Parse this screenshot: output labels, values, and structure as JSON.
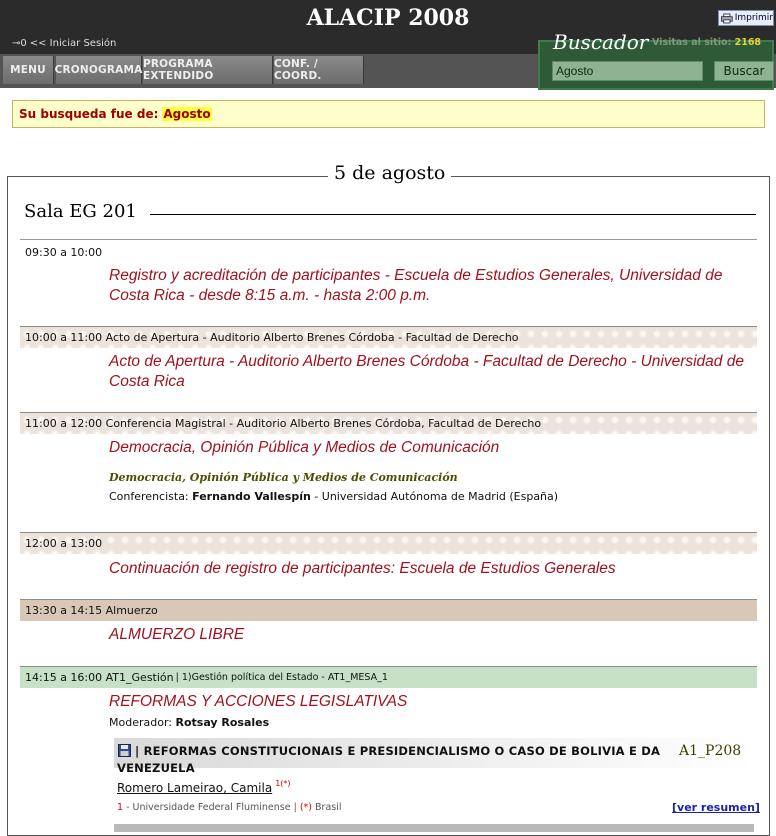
{
  "header": {
    "site_title": "ALACIP 2008",
    "print_label": "Imprimir",
    "login_label": "<< Iniciar Sesión",
    "tabs": [
      "MENU",
      "CRONOGRAMA",
      "PROGRAMA EXTENDIDO",
      "CONF. / COORD."
    ],
    "search": {
      "title": "Buscador",
      "visits_label": "Visitas al sitio:",
      "visits_count": "2168",
      "query": "Agosto",
      "button_label": "Buscar"
    }
  },
  "result_note": {
    "label": "Su busqueda fue de:",
    "term": "Agosto"
  },
  "day_title": "5 de agosto",
  "room_title": "Sala EG 201",
  "slots": [
    {
      "time": "09:30 a 10:00",
      "header_rest": "",
      "title": "Registro y acreditación de participantes - Escuela de Estudios Generales, Universidad de Costa Rica - desde 8:15 a.m. - hasta 2:00 p.m."
    },
    {
      "time": "10:00 a 11:00",
      "header_rest": "Acto de Apertura - Auditorio Alberto Brenes Córdoba - Facultad de Derecho",
      "title": "Acto de Apertura - Auditorio Alberto Brenes Córdoba - Facultad de Derecho - Universidad de Costa Rica"
    },
    {
      "time": "11:00 a 12:00",
      "header_rest": "Conferencia Magistral - Auditorio Alberto Brenes Córdoba, Facultad de Derecho",
      "title": "Democracia, Opinión Pública y Medios de Comunicación",
      "subtitle": "Democracia, Opinión Pública y Medios de Comunicación",
      "speaker_label": "Conferencista:",
      "speaker_name": "Fernando Vallespín",
      "speaker_affiliation": "- Universidad Autónoma de Madrid (España)"
    },
    {
      "time": "12:00 a 13:00",
      "header_rest": "",
      "title": "Continuación de registro de participantes: Escuela de Estudios Generales"
    },
    {
      "time": "13:30 a 14:15",
      "header_rest": "Almuerzo",
      "title": "ALMUERZO LIBRE"
    },
    {
      "time": "14:15 a 16:00",
      "header_rest": "AT1_Gestión",
      "header_small": "| 1)Gestión política del Estado - AT1_MESA_1",
      "title": "REFORMAS Y ACCIONES LEGISLATIVAS",
      "moderator_label": "Moderador:",
      "moderator_name": "Rotsay Rosales"
    }
  ],
  "paper": {
    "title": "| REFORMAS CONSTITUCIONAIS E PRESIDENCIALISMO O CASO DE BOLIVIA E DA VENEZUELA",
    "code": "A1_P208",
    "author": "Romero Lameirao, Camila",
    "author_sup": "1(*)",
    "affil_num": "1",
    "affil_text": " - Universidade Federal Fluminense | ",
    "affil_star": "(*)",
    "affil_country": " Brasil",
    "summary_link": "[ver resumen]"
  }
}
